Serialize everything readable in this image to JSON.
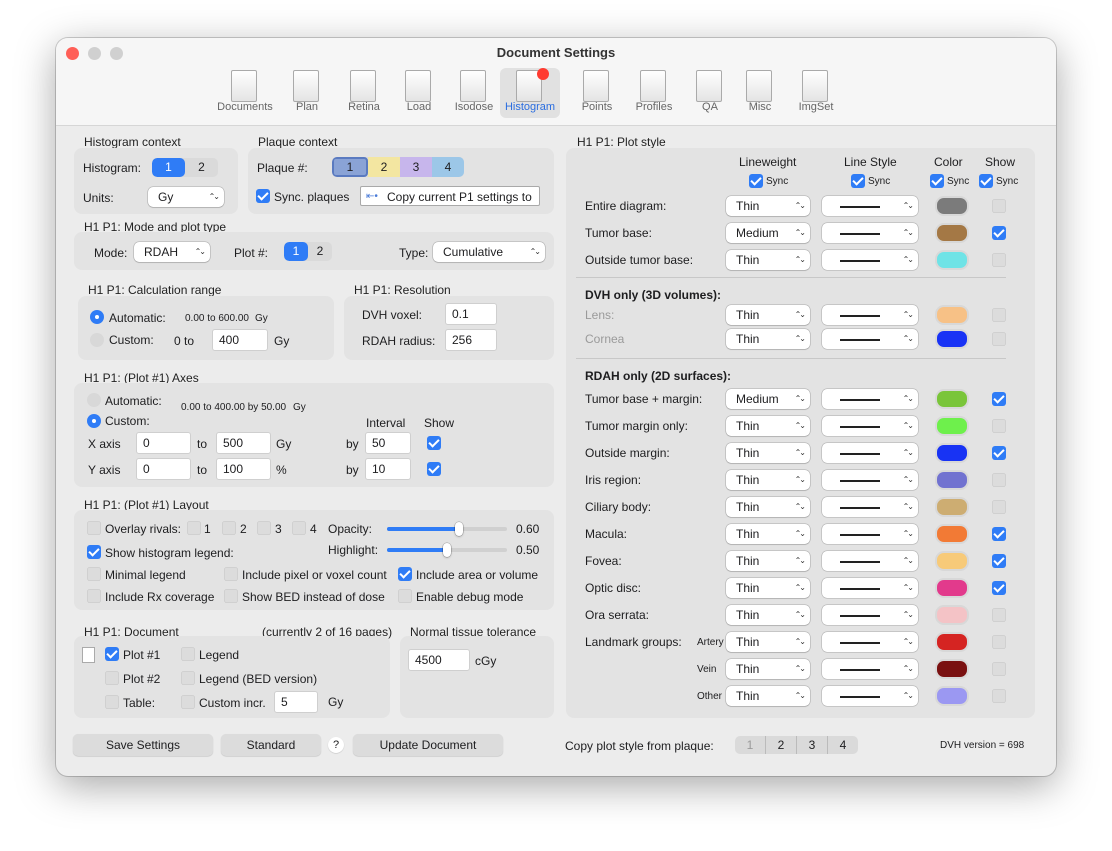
{
  "window": {
    "title": "Document Settings"
  },
  "toolbar": {
    "items": [
      {
        "label": "Documents",
        "icon": "documents-icon"
      },
      {
        "label": "Plan",
        "icon": "plan-icon"
      },
      {
        "label": "Retina",
        "icon": "retina-icon"
      },
      {
        "label": "Load",
        "icon": "load-icon"
      },
      {
        "label": "Isodose",
        "icon": "isodose-icon"
      },
      {
        "label": "Histogram",
        "icon": "histogram-icon",
        "selected": true
      },
      {
        "label": "Points",
        "icon": "points-icon"
      },
      {
        "label": "Profiles",
        "icon": "profiles-icon"
      },
      {
        "label": "QA",
        "icon": "qa-icon"
      },
      {
        "label": "Misc",
        "icon": "misc-icon"
      },
      {
        "label": "ImgSet",
        "icon": "imgset-icon"
      }
    ]
  },
  "hist_ctx": {
    "title": "Histogram context",
    "hist_label": "Histogram:",
    "seg": [
      "1",
      "2"
    ],
    "units_label": "Units:",
    "units": "Gy"
  },
  "plaque_ctx": {
    "title": "Plaque context",
    "plaque_label": "Plaque #:",
    "seg": [
      "1",
      "2",
      "3",
      "4"
    ],
    "sync_label": "Sync. plaques",
    "copy_btn": "Copy current P1 settings to"
  },
  "mode": {
    "title": "H1 P1: Mode and plot type",
    "mode_label": "Mode:",
    "mode_value": "RDAH",
    "plot_label": "Plot #:",
    "plot_seg": [
      "1",
      "2"
    ],
    "type_label": "Type:",
    "type_value": "Cumulative"
  },
  "calc": {
    "title": "H1 P1: Calculation range",
    "auto_label": "Automatic:",
    "auto_range": "0.00 to 600.00",
    "auto_unit": "Gy",
    "custom_label": "Custom:",
    "custom_from": "0 to",
    "custom_value": "400",
    "custom_unit": "Gy"
  },
  "res": {
    "title": "H1 P1: Resolution",
    "dvh_label": "DVH voxel:",
    "dvh_value": "0.1",
    "rdah_label": "RDAH radius:",
    "rdah_value": "256"
  },
  "axes": {
    "title": "H1 P1: (Plot #1) Axes",
    "auto_label": "Automatic:",
    "custom_label": "Custom:",
    "auto_range": "0.00 to 400.00 by 50.00",
    "auto_unit": "Gy",
    "interval_header": "Interval",
    "show_header": "Show",
    "x_label": "X axis",
    "x_from": "0",
    "to1": "to",
    "x_to": "500",
    "x_unit": "Gy",
    "by1": "by",
    "x_by": "50",
    "y_label": "Y axis",
    "y_from": "0",
    "to2": "to",
    "y_to": "100",
    "y_unit": "%",
    "by2": "by",
    "y_by": "10"
  },
  "layout": {
    "title": "H1 P1: (Plot #1) Layout",
    "overlay_label": "Overlay rivals:",
    "rivals": [
      "1",
      "2",
      "3",
      "4"
    ],
    "opacity_label": "Opacity:",
    "opacity": 0.6,
    "opacity_text": "0.60",
    "highlight_label": "Highlight:",
    "highlight": 0.5,
    "highlight_text": "0.50",
    "show_legend": "Show histogram legend:",
    "minimal": "Minimal legend",
    "pixel": "Include pixel or voxel count",
    "area": "Include area or volume",
    "rx": "Include Rx coverage",
    "bed": "Show BED instead of dose",
    "debug": "Enable debug mode"
  },
  "doc": {
    "title": "H1 P1: Document",
    "pages": "(currently 2 of 16 pages)",
    "plot1": "Plot #1",
    "plot2": "Plot #2",
    "table": "Table:",
    "legend": "Legend",
    "legend_bed": "Legend (BED version)",
    "custom_incr": "Custom incr.",
    "incr_value": "5",
    "incr_unit": "Gy"
  },
  "tol": {
    "title": "Normal tissue tolerance",
    "value": "4500",
    "unit": "cGy"
  },
  "style": {
    "title": "H1 P1: Plot style",
    "col_lineweight": "Lineweight",
    "col_linestyle": "Line Style",
    "col_color": "Color",
    "col_show": "Show",
    "sync": "Sync",
    "dvh_header": "DVH only (3D volumes):",
    "rdah_header": "RDAH only (2D surfaces):",
    "rows_top": [
      {
        "label": "Entire diagram:",
        "weight": "Thin",
        "color": "#7b7b7b",
        "show": false
      },
      {
        "label": "Tumor base:",
        "weight": "Medium",
        "color": "#a47845",
        "show": true
      },
      {
        "label": "Outside tumor base:",
        "weight": "Thin",
        "color": "#6fe3e6",
        "show": false
      }
    ],
    "rows_dvh": [
      {
        "label": "Lens:",
        "weight": "Thin",
        "color": "#f7c186",
        "show": false
      },
      {
        "label": "Cornea",
        "weight": "Thin",
        "color": "#1933f5",
        "show": false
      }
    ],
    "rows_rdah": [
      {
        "label": "Tumor base + margin:",
        "weight": "Medium",
        "color": "#7ac53a",
        "show": true
      },
      {
        "label": "Tumor margin only:",
        "weight": "Thin",
        "color": "#6ef04c",
        "show": false
      },
      {
        "label": "Outside margin:",
        "weight": "Thin",
        "color": "#1833f4",
        "show": true
      },
      {
        "label": "Iris region:",
        "weight": "Thin",
        "color": "#7172d0",
        "show": false
      },
      {
        "label": "Ciliary body:",
        "weight": "Thin",
        "color": "#cdad72",
        "show": false
      },
      {
        "label": "Macula:",
        "weight": "Thin",
        "color": "#f27a35",
        "show": true
      },
      {
        "label": "Fovea:",
        "weight": "Thin",
        "color": "#f7ca79",
        "show": true
      },
      {
        "label": "Optic disc:",
        "weight": "Thin",
        "color": "#e23a8c",
        "show": true
      },
      {
        "label": "Ora serrata:",
        "weight": "Thin",
        "color": "#f4c3c6",
        "show": false
      },
      {
        "label": "Landmark groups:",
        "sub": "Artery",
        "weight": "Thin",
        "color": "#d52422",
        "show": false
      },
      {
        "label": "",
        "sub": "Vein",
        "weight": "Thin",
        "color": "#7a1111",
        "show": false
      },
      {
        "label": "",
        "sub": "Other",
        "weight": "Thin",
        "color": "#9b98f2",
        "show": false
      }
    ]
  },
  "footer": {
    "save": "Save Settings",
    "standard": "Standard",
    "help": "?",
    "update": "Update Document",
    "copy_label": "Copy plot style from plaque:",
    "copy_seg": [
      "1",
      "2",
      "3",
      "4"
    ],
    "version": "DVH version = 698"
  }
}
